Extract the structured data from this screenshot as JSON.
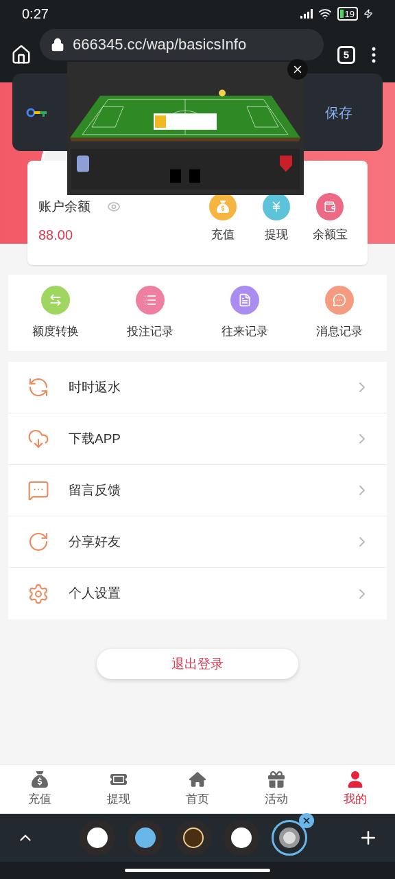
{
  "status_bar": {
    "time": "0:27",
    "battery": "19"
  },
  "browser": {
    "url": "666345.cc/wap/basicsInfo",
    "tab_count": "5"
  },
  "password_prompt": {
    "button": "保存"
  },
  "account": {
    "label": "账户余额",
    "balance": "88.00",
    "actions": [
      {
        "label": "充值",
        "color": "#f6b540"
      },
      {
        "label": "提现",
        "color": "#5cc3d8"
      },
      {
        "label": "余额宝",
        "color": "#ec6a86"
      }
    ]
  },
  "shortcuts": [
    {
      "label": "额度转换",
      "color": "#9ed660"
    },
    {
      "label": "投注记录",
      "color": "#ef7fa0"
    },
    {
      "label": "往来记录",
      "color": "#a98df0"
    },
    {
      "label": "消息记录",
      "color": "#f59c80"
    }
  ],
  "menu": [
    {
      "label": "时时返水"
    },
    {
      "label": "下载APP"
    },
    {
      "label": "留言反馈"
    },
    {
      "label": "分享好友"
    },
    {
      "label": "个人设置"
    }
  ],
  "logout": "退出登录",
  "bottom_nav": [
    {
      "label": "充值",
      "selected": false
    },
    {
      "label": "提现",
      "selected": false
    },
    {
      "label": "首页",
      "selected": false
    },
    {
      "label": "活动",
      "selected": false
    },
    {
      "label": "我的",
      "selected": true
    }
  ]
}
